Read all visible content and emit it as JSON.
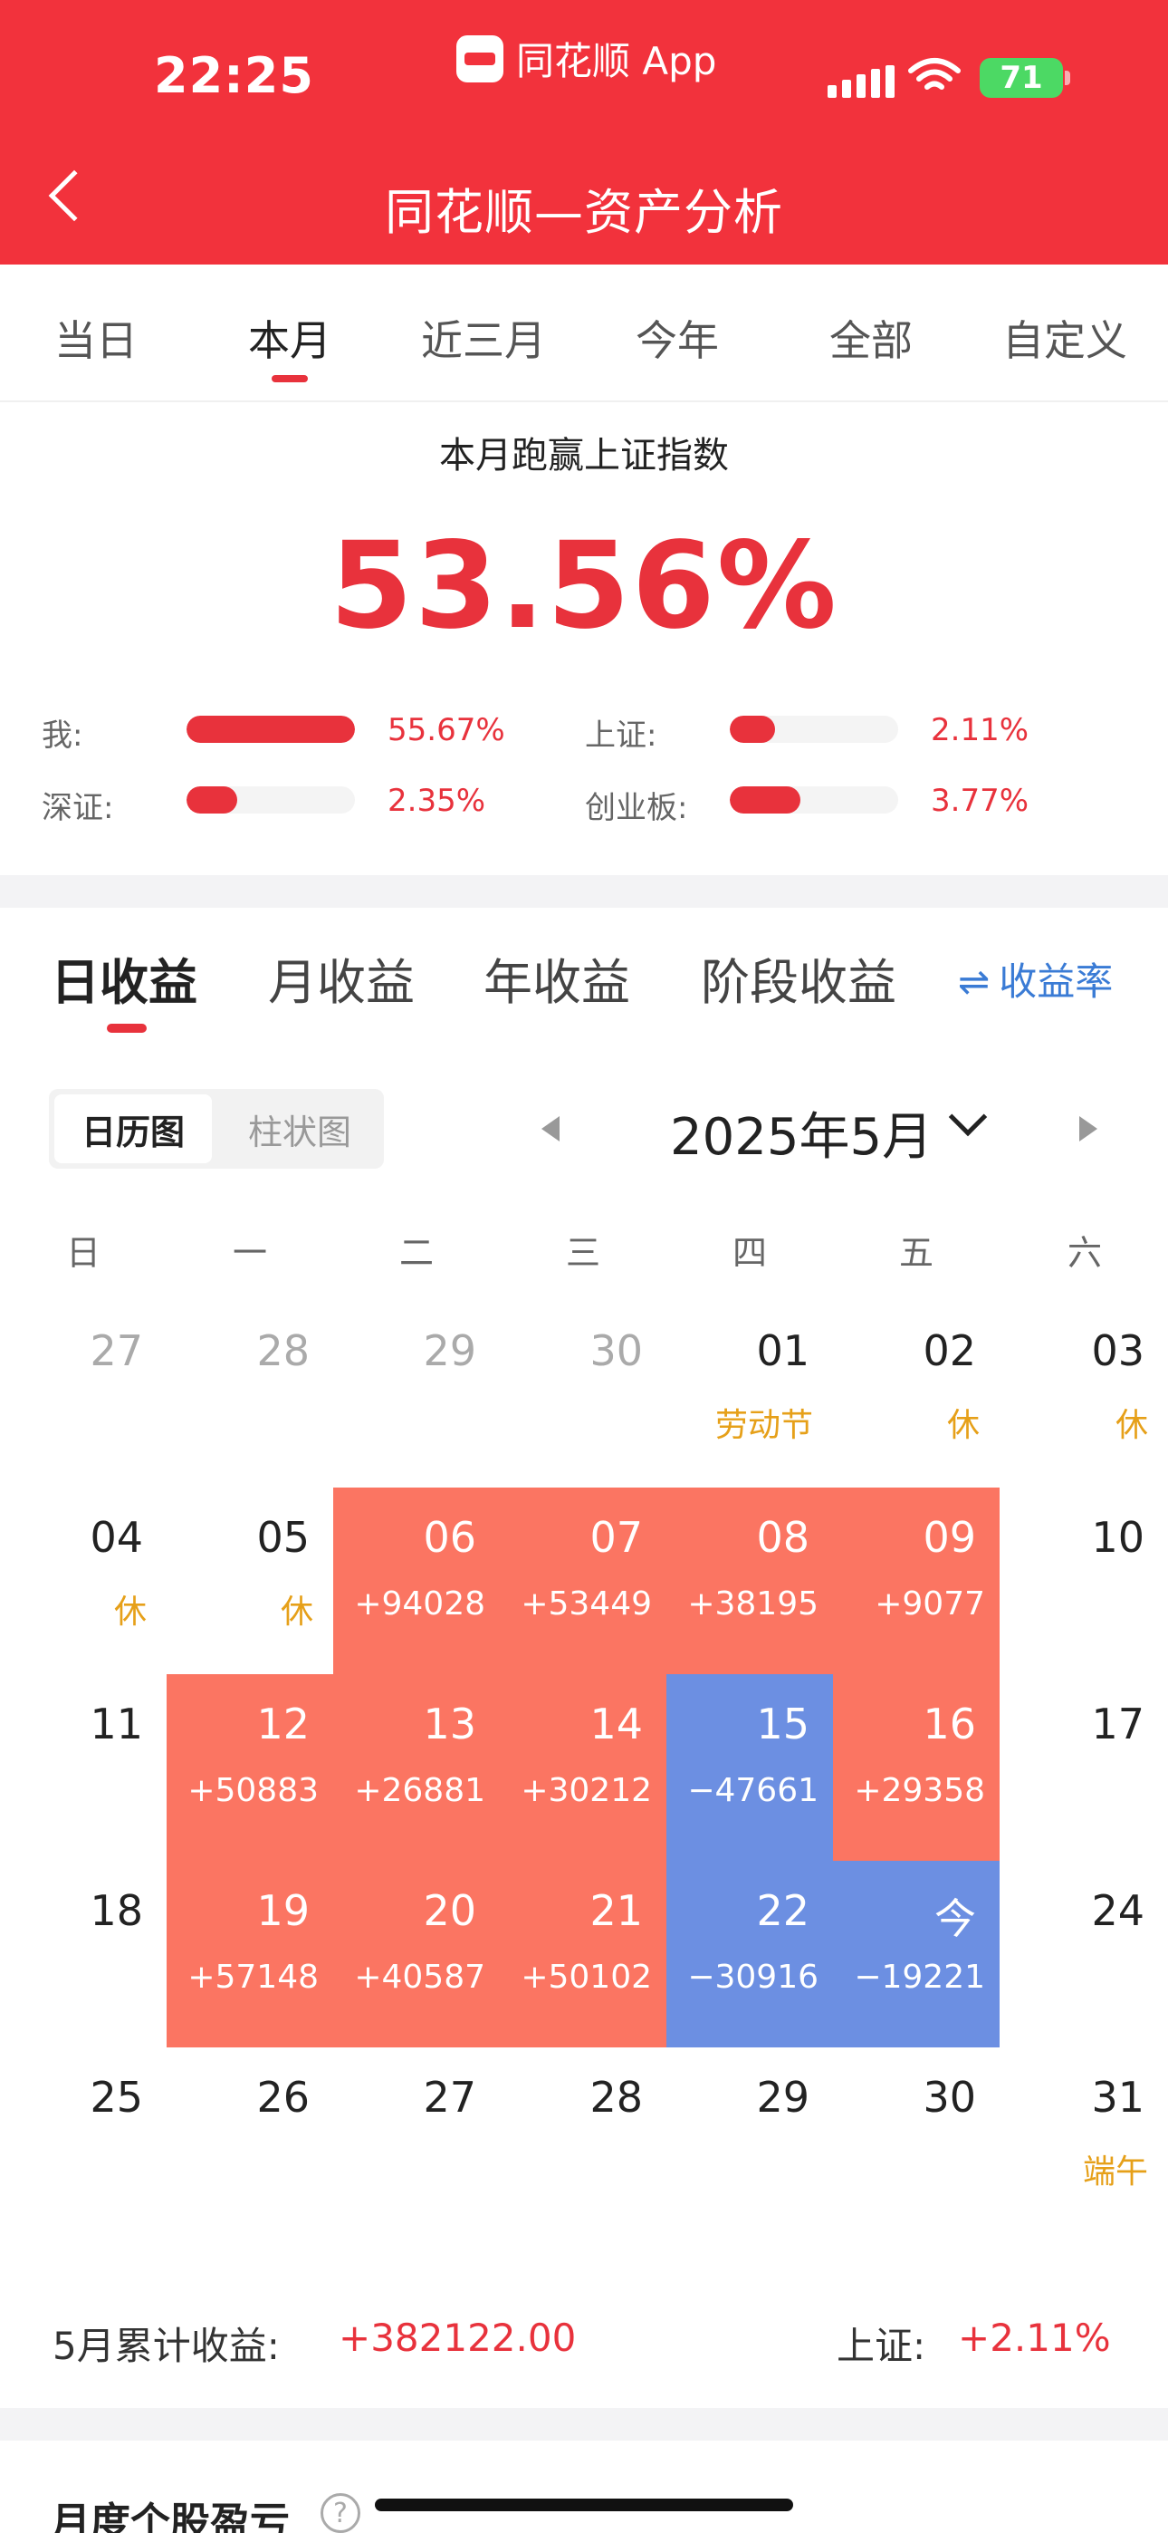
{
  "status_bar": {
    "time": "22:25",
    "app_name": "同花顺 App",
    "battery": "71"
  },
  "header": {
    "title": "同花顺—资产分析"
  },
  "period_tabs": [
    {
      "label": "当日"
    },
    {
      "label": "本月"
    },
    {
      "label": "近三月"
    },
    {
      "label": "今年"
    },
    {
      "label": "全部"
    },
    {
      "label": "自定义"
    }
  ],
  "summary": {
    "title": "本月跑赢上证指数",
    "value": "53.56%",
    "comparisons": [
      {
        "label": "我:",
        "value": "55.67%",
        "fraction": 1.0
      },
      {
        "label": "上证:",
        "value": "2.11%",
        "fraction": 0.27
      },
      {
        "label": "深证:",
        "value": "2.35%",
        "fraction": 0.3
      },
      {
        "label": "创业板:",
        "value": "3.77%",
        "fraction": 0.42
      }
    ]
  },
  "income_tabs": [
    {
      "label": "日收益"
    },
    {
      "label": "月收益"
    },
    {
      "label": "年收益"
    },
    {
      "label": "阶段收益"
    }
  ],
  "rate_link": {
    "icon": "swap-icon",
    "label": "收益率"
  },
  "view_toggle": {
    "active": "日历图",
    "inactive": "柱状图"
  },
  "month_selector": {
    "label": "2025年5月"
  },
  "weekdays": [
    "日",
    "一",
    "二",
    "三",
    "四",
    "五",
    "六"
  ],
  "calendar_rows": [
    [
      {
        "day": "27",
        "muted": true
      },
      {
        "day": "28",
        "muted": true
      },
      {
        "day": "29",
        "muted": true
      },
      {
        "day": "30",
        "muted": true
      },
      {
        "day": "01",
        "note": "劳动节"
      },
      {
        "day": "02",
        "note": "休"
      },
      {
        "day": "03",
        "note": "休"
      }
    ],
    [
      {
        "day": "04",
        "note": "休"
      },
      {
        "day": "05",
        "note": "休"
      },
      {
        "day": "06",
        "amount": "+94028",
        "kind": "gain"
      },
      {
        "day": "07",
        "amount": "+53449",
        "kind": "gain"
      },
      {
        "day": "08",
        "amount": "+38195",
        "kind": "gain"
      },
      {
        "day": "09",
        "amount": "+9077",
        "kind": "gain"
      },
      {
        "day": "10"
      }
    ],
    [
      {
        "day": "11"
      },
      {
        "day": "12",
        "amount": "+50883",
        "kind": "gain"
      },
      {
        "day": "13",
        "amount": "+26881",
        "kind": "gain"
      },
      {
        "day": "14",
        "amount": "+30212",
        "kind": "gain"
      },
      {
        "day": "15",
        "amount": "−47661",
        "kind": "loss"
      },
      {
        "day": "16",
        "amount": "+29358",
        "kind": "gain"
      },
      {
        "day": "17"
      }
    ],
    [
      {
        "day": "18"
      },
      {
        "day": "19",
        "amount": "+57148",
        "kind": "gain"
      },
      {
        "day": "20",
        "amount": "+40587",
        "kind": "gain"
      },
      {
        "day": "21",
        "amount": "+50102",
        "kind": "gain"
      },
      {
        "day": "22",
        "amount": "−30916",
        "kind": "loss"
      },
      {
        "day": "今",
        "amount": "−19221",
        "kind": "loss"
      },
      {
        "day": "24"
      }
    ],
    [
      {
        "day": "25"
      },
      {
        "day": "26"
      },
      {
        "day": "27"
      },
      {
        "day": "28"
      },
      {
        "day": "29"
      },
      {
        "day": "30"
      },
      {
        "day": "31",
        "note": "端午"
      }
    ]
  ],
  "month_total": {
    "label": "5月累计收益:",
    "value": "+382122.00",
    "index_label": "上证:",
    "index_value": "+2.11%"
  },
  "section_title": "月度个股盈亏",
  "colors": {
    "brand_red": "#f2323c",
    "gain": "#fb7562",
    "loss": "#6c8fe2",
    "holiday": "#e6a019",
    "link": "#3a7bd5"
  }
}
